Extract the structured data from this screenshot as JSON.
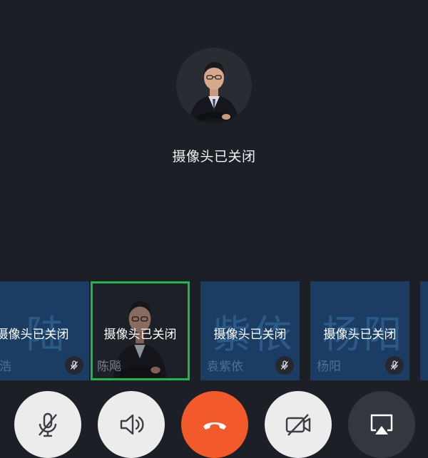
{
  "main": {
    "status": "摄像头已关闭",
    "avatar_icon": "person-portrait"
  },
  "participants": [
    {
      "watermark": "陆",
      "status": "摄像头已关闭",
      "name": "陆浩",
      "muted": true,
      "camera": "off"
    },
    {
      "watermark": "",
      "status": "摄像头已关闭",
      "name": "陈飚",
      "muted": false,
      "camera": "on",
      "active_speaker": true
    },
    {
      "watermark": "紫依",
      "status": "摄像头已关闭",
      "name": "袁紫依",
      "muted": true,
      "camera": "off"
    },
    {
      "watermark": "杨阳",
      "status": "摄像头已关闭",
      "name": "杨阳",
      "muted": true,
      "camera": "off"
    },
    {
      "watermark": "",
      "status": "",
      "name": "",
      "muted": false,
      "camera": "off"
    }
  ],
  "controls": [
    {
      "icon": "mic-off-icon"
    },
    {
      "icon": "speaker-icon"
    },
    {
      "icon": "hang-up-icon"
    },
    {
      "icon": "camera-off-icon"
    },
    {
      "icon": "airplay-icon"
    }
  ],
  "colors": {
    "background": "#1c1f26",
    "tile": "#1b3d63",
    "active_border": "#1fb54b",
    "hangup": "#f25a2b",
    "control_light": "#ececec",
    "control_dark": "#34373e"
  }
}
